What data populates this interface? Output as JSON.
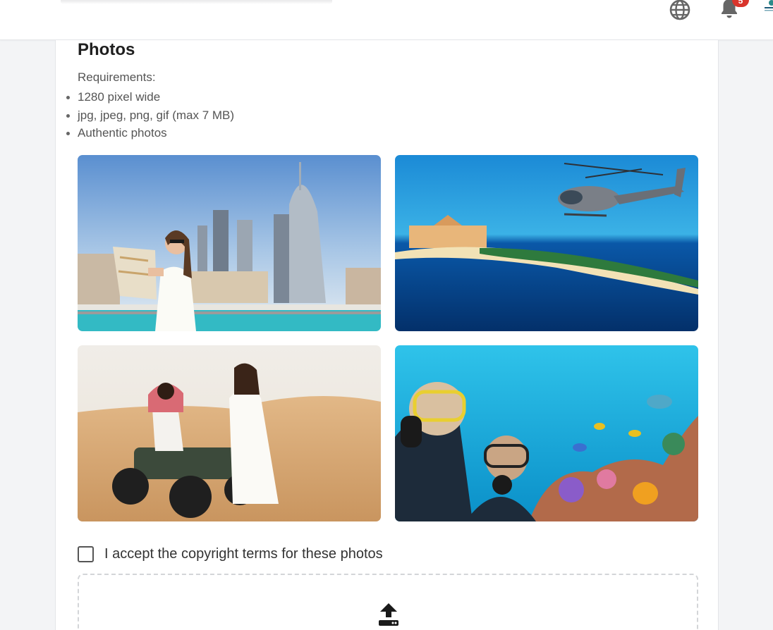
{
  "header": {
    "notification_count": "5",
    "icons": [
      "globe-icon",
      "bell-icon",
      "avatar-logo"
    ]
  },
  "photos_section": {
    "title": "Photos",
    "requirements_heading": "Requirements:",
    "requirements": [
      "1280 pixel wide",
      "jpg, jpeg, png, gif (max 7 MB)",
      "Authentic photos"
    ],
    "photos": [
      {
        "name": "city-tourist-photo"
      },
      {
        "name": "helicopter-palm-photo"
      },
      {
        "name": "desert-quad-photo"
      },
      {
        "name": "diving-reef-photo"
      }
    ],
    "accept_label": "I accept the copyright terms for these photos",
    "accept_checked": false,
    "upload_icon": "upload-icon"
  },
  "colors": {
    "badge": "#d9342b",
    "page_bg": "#f3f4f6",
    "card_bg": "#ffffff"
  }
}
